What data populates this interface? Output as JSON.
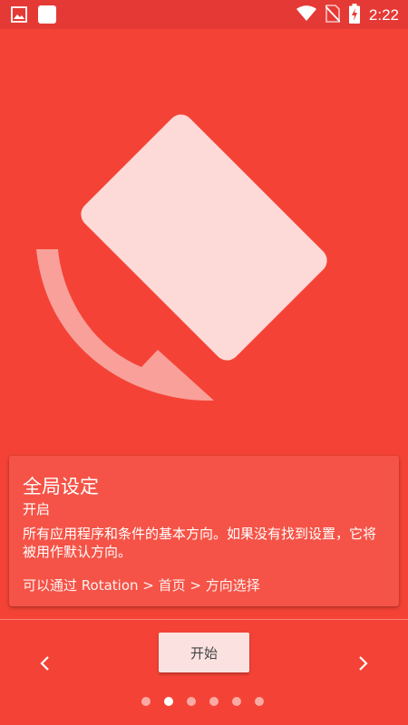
{
  "status_bar": {
    "time": "2:22",
    "icons": [
      "image-icon",
      "app-square-icon",
      "wifi-icon",
      "no-sim-icon",
      "battery-charging-icon"
    ]
  },
  "card": {
    "title": "全局设定",
    "status": "开启",
    "description": "所有应用程序和条件的基本方向。如果没有找到设置，它将被用作默认方向。",
    "hint": "可以通过 Rotation > 首页 > 方向选择"
  },
  "footer": {
    "start_label": "开始",
    "prev_icon": "chevron-left-icon",
    "next_icon": "chevron-right-icon",
    "page_count": 6,
    "current_page": 2
  },
  "colors": {
    "background": "#F44336",
    "status_bar": "#E53935",
    "card": "#F55347",
    "phone_shape": "#FDDAD8",
    "arrow": "#F9A09A",
    "button": "#FBE2E1"
  }
}
